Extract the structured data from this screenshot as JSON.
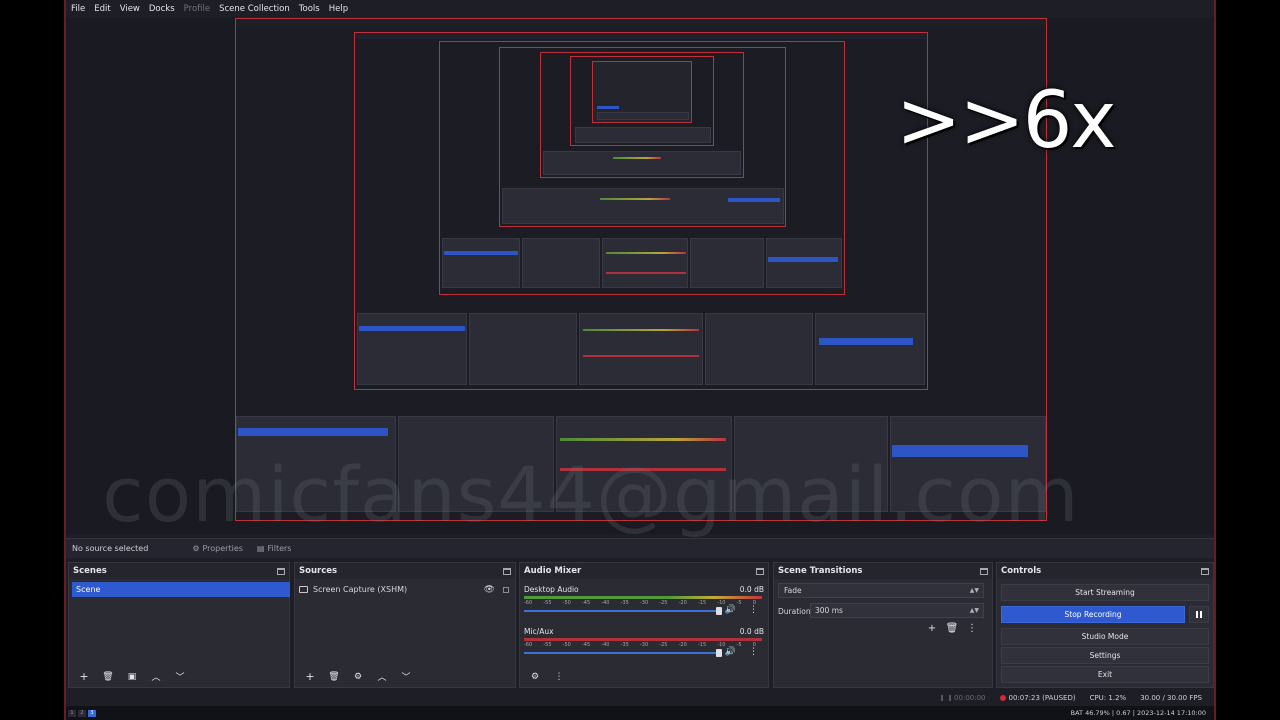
{
  "menu": [
    {
      "label": "File",
      "enabled": true
    },
    {
      "label": "Edit",
      "enabled": true
    },
    {
      "label": "View",
      "enabled": true
    },
    {
      "label": "Docks",
      "enabled": true
    },
    {
      "label": "Profile",
      "enabled": false
    },
    {
      "label": "Scene Collection",
      "enabled": true
    },
    {
      "label": "Tools",
      "enabled": true
    },
    {
      "label": "Help",
      "enabled": true
    }
  ],
  "overlay": {
    "speed": ">>6x",
    "watermark": "comicfans44@gmail.com"
  },
  "source_bar": {
    "no_source": "No source selected",
    "properties_tab": "Properties",
    "filters_tab": "Filters"
  },
  "scenes": {
    "title": "Scenes",
    "items": [
      "Scene"
    ]
  },
  "sources": {
    "title": "Sources",
    "items": [
      "Screen Capture (XSHM)"
    ]
  },
  "mixer": {
    "title": "Audio Mixer",
    "channels": [
      {
        "name": "Desktop Audio",
        "db": "0.0 dB",
        "meter": "green"
      },
      {
        "name": "Mic/Aux",
        "db": "0.0 dB",
        "meter": "red"
      }
    ],
    "ticks": [
      "-60",
      "-55",
      "-50",
      "-45",
      "-40",
      "-35",
      "-30",
      "-25",
      "-20",
      "-15",
      "-10",
      "-5",
      "0"
    ]
  },
  "transitions": {
    "title": "Scene Transitions",
    "selected": "Fade",
    "duration_label": "Duration",
    "duration_value": "300 ms"
  },
  "controls": {
    "title": "Controls",
    "start_streaming": "Start Streaming",
    "stop_recording": "Stop Recording",
    "studio_mode": "Studio Mode",
    "settings": "Settings",
    "exit": "Exit"
  },
  "status": {
    "stream_time": "00:00:00",
    "rec_time": "00:07:23 (PAUSED)",
    "cpu": "CPU: 1.2%",
    "fps": "30.00 / 30.00 FPS"
  },
  "taskbar": {
    "workspaces": [
      "1",
      "2",
      "3"
    ],
    "active_workspace": 3,
    "tray": "BAT 46.79% | 0.67 | 2023-12-14 17:10:00"
  },
  "colors": {
    "accent": "#2e59cf",
    "record": "#d02b35",
    "panel": "#2a2b33",
    "background": "#1e1f26"
  }
}
